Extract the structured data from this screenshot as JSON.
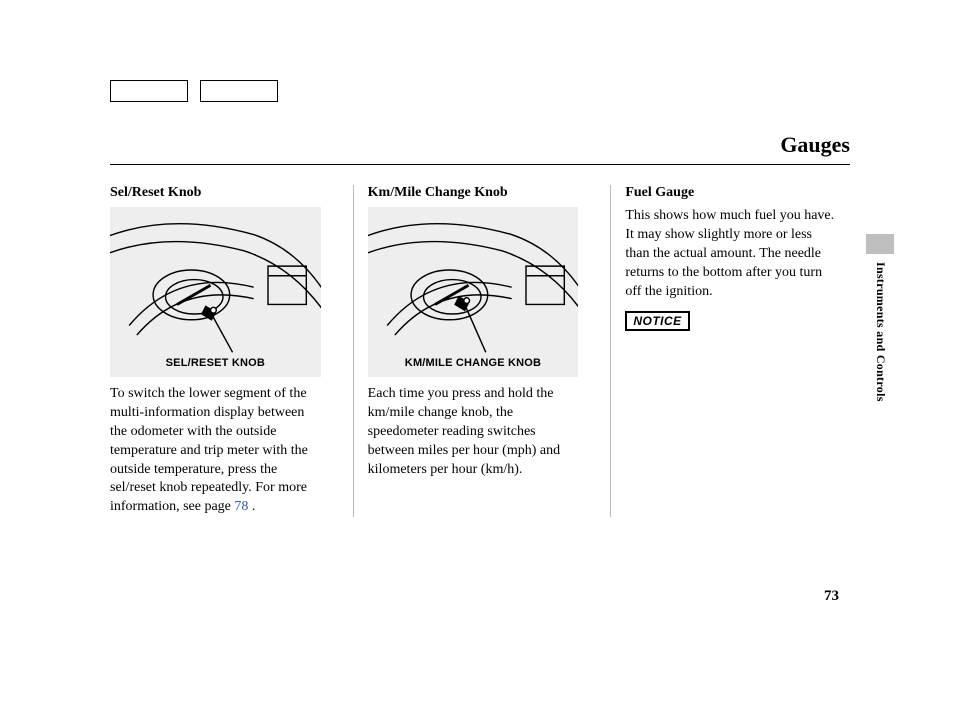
{
  "header": {
    "title": "Gauges"
  },
  "side": {
    "section_label": "Instruments and Controls"
  },
  "page_number": "73",
  "columns": [
    {
      "heading": "Sel/Reset Knob",
      "figure_caption": "SEL/RESET KNOB",
      "body": "To switch the lower segment of the multi-information display between the odometer with the outside temperature and trip meter with the outside temperature, press the sel/reset knob repeatedly. For more information, see page ",
      "page_ref": "78",
      "body_after": " ."
    },
    {
      "heading": "Km/Mile Change Knob",
      "figure_caption": "KM/MILE CHANGE KNOB",
      "body": "Each time you press and hold the km/mile change knob, the speedometer reading switches between miles per hour (mph) and kilometers per hour (km/h)."
    },
    {
      "heading": "Fuel Gauge",
      "body": "This shows how much fuel you have. It may show slightly more or less than the actual amount. The needle returns to the bottom after you turn off the ignition.",
      "notice": "NOTICE"
    }
  ]
}
